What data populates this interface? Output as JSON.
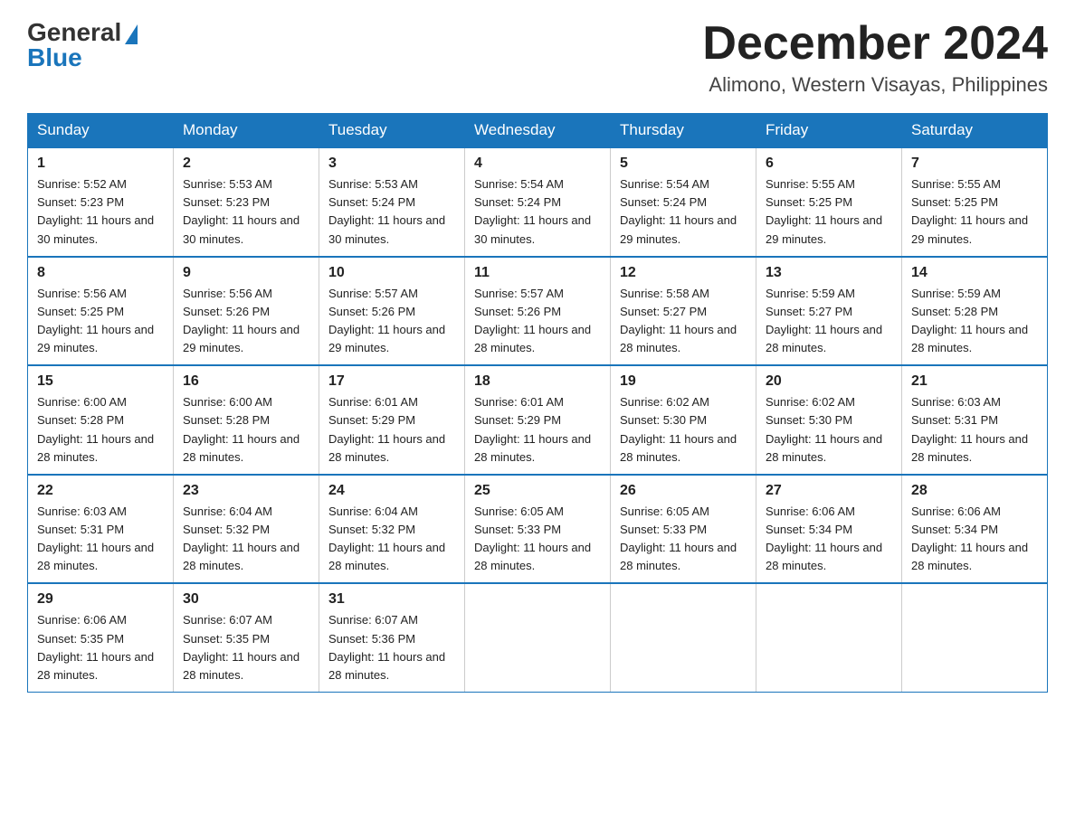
{
  "header": {
    "logo_general": "General",
    "logo_blue": "Blue",
    "title": "December 2024",
    "subtitle": "Alimono, Western Visayas, Philippines"
  },
  "weekdays": [
    "Sunday",
    "Monday",
    "Tuesday",
    "Wednesday",
    "Thursday",
    "Friday",
    "Saturday"
  ],
  "weeks": [
    [
      {
        "day": "1",
        "sunrise": "Sunrise: 5:52 AM",
        "sunset": "Sunset: 5:23 PM",
        "daylight": "Daylight: 11 hours and 30 minutes."
      },
      {
        "day": "2",
        "sunrise": "Sunrise: 5:53 AM",
        "sunset": "Sunset: 5:23 PM",
        "daylight": "Daylight: 11 hours and 30 minutes."
      },
      {
        "day": "3",
        "sunrise": "Sunrise: 5:53 AM",
        "sunset": "Sunset: 5:24 PM",
        "daylight": "Daylight: 11 hours and 30 minutes."
      },
      {
        "day": "4",
        "sunrise": "Sunrise: 5:54 AM",
        "sunset": "Sunset: 5:24 PM",
        "daylight": "Daylight: 11 hours and 30 minutes."
      },
      {
        "day": "5",
        "sunrise": "Sunrise: 5:54 AM",
        "sunset": "Sunset: 5:24 PM",
        "daylight": "Daylight: 11 hours and 29 minutes."
      },
      {
        "day": "6",
        "sunrise": "Sunrise: 5:55 AM",
        "sunset": "Sunset: 5:25 PM",
        "daylight": "Daylight: 11 hours and 29 minutes."
      },
      {
        "day": "7",
        "sunrise": "Sunrise: 5:55 AM",
        "sunset": "Sunset: 5:25 PM",
        "daylight": "Daylight: 11 hours and 29 minutes."
      }
    ],
    [
      {
        "day": "8",
        "sunrise": "Sunrise: 5:56 AM",
        "sunset": "Sunset: 5:25 PM",
        "daylight": "Daylight: 11 hours and 29 minutes."
      },
      {
        "day": "9",
        "sunrise": "Sunrise: 5:56 AM",
        "sunset": "Sunset: 5:26 PM",
        "daylight": "Daylight: 11 hours and 29 minutes."
      },
      {
        "day": "10",
        "sunrise": "Sunrise: 5:57 AM",
        "sunset": "Sunset: 5:26 PM",
        "daylight": "Daylight: 11 hours and 29 minutes."
      },
      {
        "day": "11",
        "sunrise": "Sunrise: 5:57 AM",
        "sunset": "Sunset: 5:26 PM",
        "daylight": "Daylight: 11 hours and 28 minutes."
      },
      {
        "day": "12",
        "sunrise": "Sunrise: 5:58 AM",
        "sunset": "Sunset: 5:27 PM",
        "daylight": "Daylight: 11 hours and 28 minutes."
      },
      {
        "day": "13",
        "sunrise": "Sunrise: 5:59 AM",
        "sunset": "Sunset: 5:27 PM",
        "daylight": "Daylight: 11 hours and 28 minutes."
      },
      {
        "day": "14",
        "sunrise": "Sunrise: 5:59 AM",
        "sunset": "Sunset: 5:28 PM",
        "daylight": "Daylight: 11 hours and 28 minutes."
      }
    ],
    [
      {
        "day": "15",
        "sunrise": "Sunrise: 6:00 AM",
        "sunset": "Sunset: 5:28 PM",
        "daylight": "Daylight: 11 hours and 28 minutes."
      },
      {
        "day": "16",
        "sunrise": "Sunrise: 6:00 AM",
        "sunset": "Sunset: 5:28 PM",
        "daylight": "Daylight: 11 hours and 28 minutes."
      },
      {
        "day": "17",
        "sunrise": "Sunrise: 6:01 AM",
        "sunset": "Sunset: 5:29 PM",
        "daylight": "Daylight: 11 hours and 28 minutes."
      },
      {
        "day": "18",
        "sunrise": "Sunrise: 6:01 AM",
        "sunset": "Sunset: 5:29 PM",
        "daylight": "Daylight: 11 hours and 28 minutes."
      },
      {
        "day": "19",
        "sunrise": "Sunrise: 6:02 AM",
        "sunset": "Sunset: 5:30 PM",
        "daylight": "Daylight: 11 hours and 28 minutes."
      },
      {
        "day": "20",
        "sunrise": "Sunrise: 6:02 AM",
        "sunset": "Sunset: 5:30 PM",
        "daylight": "Daylight: 11 hours and 28 minutes."
      },
      {
        "day": "21",
        "sunrise": "Sunrise: 6:03 AM",
        "sunset": "Sunset: 5:31 PM",
        "daylight": "Daylight: 11 hours and 28 minutes."
      }
    ],
    [
      {
        "day": "22",
        "sunrise": "Sunrise: 6:03 AM",
        "sunset": "Sunset: 5:31 PM",
        "daylight": "Daylight: 11 hours and 28 minutes."
      },
      {
        "day": "23",
        "sunrise": "Sunrise: 6:04 AM",
        "sunset": "Sunset: 5:32 PM",
        "daylight": "Daylight: 11 hours and 28 minutes."
      },
      {
        "day": "24",
        "sunrise": "Sunrise: 6:04 AM",
        "sunset": "Sunset: 5:32 PM",
        "daylight": "Daylight: 11 hours and 28 minutes."
      },
      {
        "day": "25",
        "sunrise": "Sunrise: 6:05 AM",
        "sunset": "Sunset: 5:33 PM",
        "daylight": "Daylight: 11 hours and 28 minutes."
      },
      {
        "day": "26",
        "sunrise": "Sunrise: 6:05 AM",
        "sunset": "Sunset: 5:33 PM",
        "daylight": "Daylight: 11 hours and 28 minutes."
      },
      {
        "day": "27",
        "sunrise": "Sunrise: 6:06 AM",
        "sunset": "Sunset: 5:34 PM",
        "daylight": "Daylight: 11 hours and 28 minutes."
      },
      {
        "day": "28",
        "sunrise": "Sunrise: 6:06 AM",
        "sunset": "Sunset: 5:34 PM",
        "daylight": "Daylight: 11 hours and 28 minutes."
      }
    ],
    [
      {
        "day": "29",
        "sunrise": "Sunrise: 6:06 AM",
        "sunset": "Sunset: 5:35 PM",
        "daylight": "Daylight: 11 hours and 28 minutes."
      },
      {
        "day": "30",
        "sunrise": "Sunrise: 6:07 AM",
        "sunset": "Sunset: 5:35 PM",
        "daylight": "Daylight: 11 hours and 28 minutes."
      },
      {
        "day": "31",
        "sunrise": "Sunrise: 6:07 AM",
        "sunset": "Sunset: 5:36 PM",
        "daylight": "Daylight: 11 hours and 28 minutes."
      },
      {
        "day": "",
        "sunrise": "",
        "sunset": "",
        "daylight": ""
      },
      {
        "day": "",
        "sunrise": "",
        "sunset": "",
        "daylight": ""
      },
      {
        "day": "",
        "sunrise": "",
        "sunset": "",
        "daylight": ""
      },
      {
        "day": "",
        "sunrise": "",
        "sunset": "",
        "daylight": ""
      }
    ]
  ]
}
